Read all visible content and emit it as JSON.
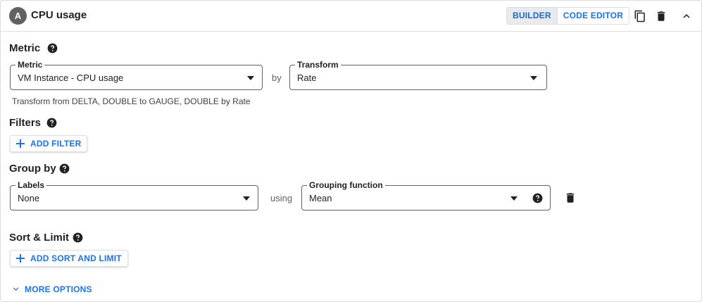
{
  "header": {
    "badge": "A",
    "title": "CPU usage",
    "mode_tabs": [
      {
        "label": "BUILDER",
        "active": true
      },
      {
        "label": "CODE EDITOR",
        "active": false
      }
    ],
    "icons": [
      "copy-icon",
      "delete-icon",
      "collapse-icon"
    ]
  },
  "metric_section": {
    "label": "Metric",
    "metric_field": {
      "label": "Metric",
      "value": "VM Instance - CPU usage"
    },
    "connector": "by",
    "transform_field": {
      "label": "Transform",
      "value": "Rate"
    },
    "hint": "Transform from DELTA, DOUBLE to GAUGE, DOUBLE by Rate"
  },
  "filters_section": {
    "label": "Filters",
    "add_button": "ADD FILTER"
  },
  "group_section": {
    "label": "Group by",
    "labels_field": {
      "label": "Labels",
      "value": "None"
    },
    "connector": "using",
    "grouping_field": {
      "label": "Grouping function",
      "value": "Mean"
    }
  },
  "sort_section": {
    "label": "Sort & Limit",
    "add_button": "ADD SORT AND LIMIT"
  },
  "more_options": "MORE OPTIONS",
  "colors": {
    "accent": "#1a73e8",
    "text": "#202124",
    "badge": "#5f6368"
  }
}
